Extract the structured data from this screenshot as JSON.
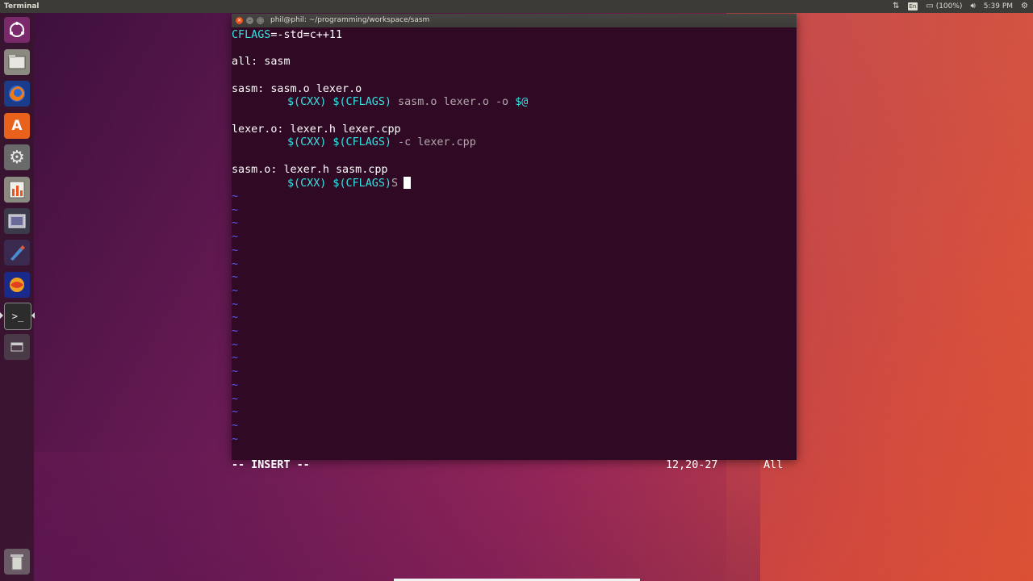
{
  "top_panel": {
    "app_title": "Terminal",
    "lang": "En",
    "battery": "(100%)",
    "time": "5:39 PM"
  },
  "launcher": {
    "items": [
      "dash",
      "files",
      "firefox",
      "software-center",
      "system-settings",
      "system-monitor",
      "screenshot",
      "editor",
      "app",
      "terminal",
      "window"
    ],
    "trash": "trash"
  },
  "window": {
    "title": "phil@phil: ~/programming/workspace/sasm"
  },
  "editor": {
    "lines": {
      "l1a": "CFLAGS",
      "l1b": "=-std=c++11",
      "l3": "all: sasm",
      "l5": "sasm: sasm.o lexer.o",
      "l6a": "$(CXX) $(CFLAGS)",
      "l6b": " sasm.o lexer.o -o ",
      "l6c": "$@",
      "l8": "lexer.o: lexer.h lexer.cpp",
      "l9a": "$(CXX) $(CFLAGS)",
      "l9b": " -c lexer.cpp",
      "l11": "sasm.o: lexer.h sasm.cpp",
      "l12a": "$(CXX) $(CFLAGS)",
      "l12b": "S"
    },
    "tilde": "~",
    "mode": "-- INSERT --",
    "position": "12,20-27",
    "scroll": "All"
  },
  "colors": {
    "terminal_bg": "#300a24",
    "variable": "#34e2e2",
    "tilde": "#5b5bff"
  }
}
